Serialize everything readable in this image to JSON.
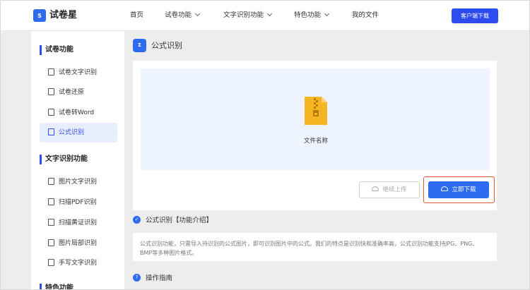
{
  "header": {
    "logo_text": "试卷星",
    "nav": [
      {
        "label": "首页",
        "dropdown": false
      },
      {
        "label": "试卷功能",
        "dropdown": true
      },
      {
        "label": "文字识别功能",
        "dropdown": true
      },
      {
        "label": "特色功能",
        "dropdown": true
      },
      {
        "label": "我的文件",
        "dropdown": false
      }
    ],
    "download_button": "客户端下载"
  },
  "sidebar": {
    "sections": [
      {
        "title": "试卷功能",
        "items": [
          "试卷文字识别",
          "试卷还原",
          "试卷转Word",
          "公式识别"
        ]
      },
      {
        "title": "文字识别功能",
        "items": [
          "图片文字识别",
          "扫描PDF识别",
          "扫描黄证识别",
          "图片局部识别",
          "手写文字识别"
        ]
      },
      {
        "title": "特色功能",
        "items": []
      }
    ],
    "active_item": "公式识别"
  },
  "main": {
    "title_icon": "Σ",
    "title": "公式识别",
    "file_name": "文件名称",
    "continue_button": "继续上传",
    "download_now_button": "立即下载",
    "intro_heading": "公式识别【功能介绍】",
    "intro_text": "公式识别功能，只需导入待识别的公式图片，即可识别图片中的公式。我们的特点是识别快和准确率高，公式识别功能支持JPG、PNG、BMP等多种图片格式。",
    "guide_heading": "操作指南"
  },
  "colors": {
    "accent": "#2d4cf0",
    "highlight": "#e05a3a",
    "upload_bg": "#eef4ff"
  }
}
